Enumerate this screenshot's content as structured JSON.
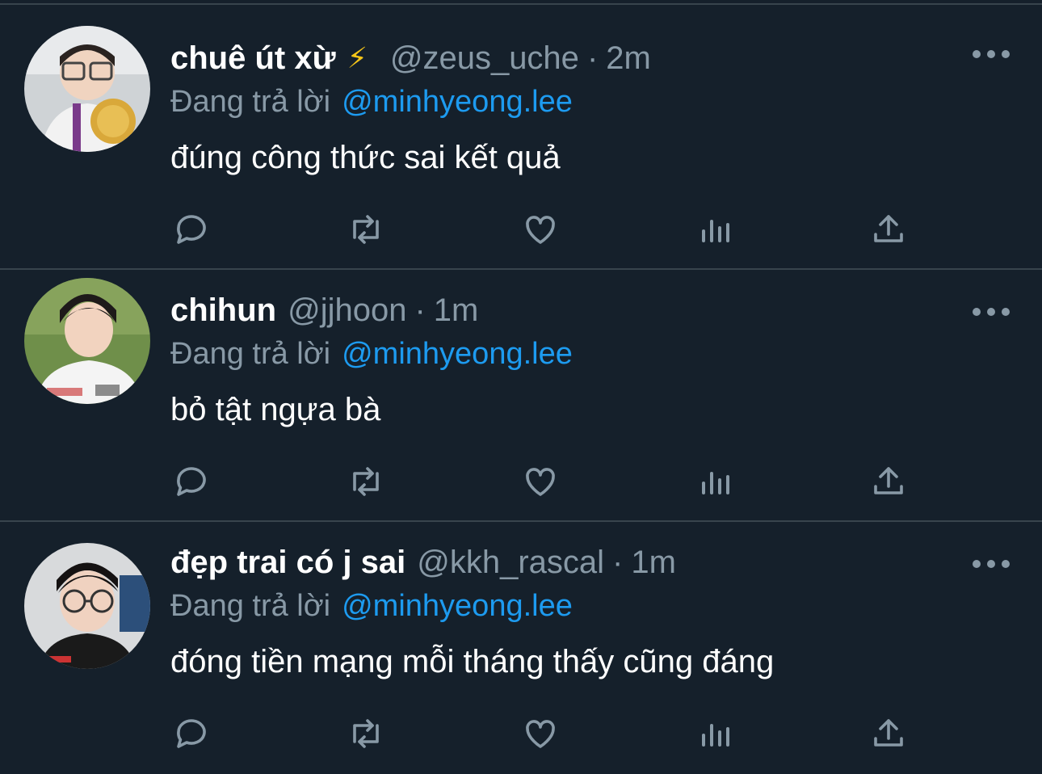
{
  "colors": {
    "background": "#15202b",
    "divider": "#38444d",
    "muted": "#8899a6",
    "mention": "#1d9bf0",
    "badge": "#f5c518"
  },
  "tweets": [
    {
      "display_name": "chuê út xừ",
      "badge": "⚡",
      "handle": "@zeus_uche",
      "separator": "·",
      "time": "2m",
      "reply_prefix": "Đang trả lời",
      "reply_mention": "@minhyeong.lee",
      "text": "đúng công thức sai kết quả",
      "avatar": "photo of person with glasses holding a gold medal"
    },
    {
      "display_name": "chihun",
      "handle": "@jjhoon",
      "separator": "·",
      "time": "1m",
      "reply_prefix": "Đang trả lời",
      "reply_mention": "@minhyeong.lee",
      "text": "bỏ tật ngựa bà",
      "avatar": "photo of person in baseball jersey"
    },
    {
      "display_name": "đẹp trai có j sai",
      "handle": "@kkh_rascal",
      "separator": "·",
      "time": "1m",
      "reply_prefix": "Đang trả lời",
      "reply_mention": "@minhyeong.lee",
      "text": "đóng tiền mạng mỗi tháng thấy cũng đáng",
      "avatar": "selfie of person with round glasses"
    }
  ],
  "actions": [
    "reply-icon",
    "retweet-icon",
    "like-icon",
    "analytics-icon",
    "share-icon"
  ]
}
